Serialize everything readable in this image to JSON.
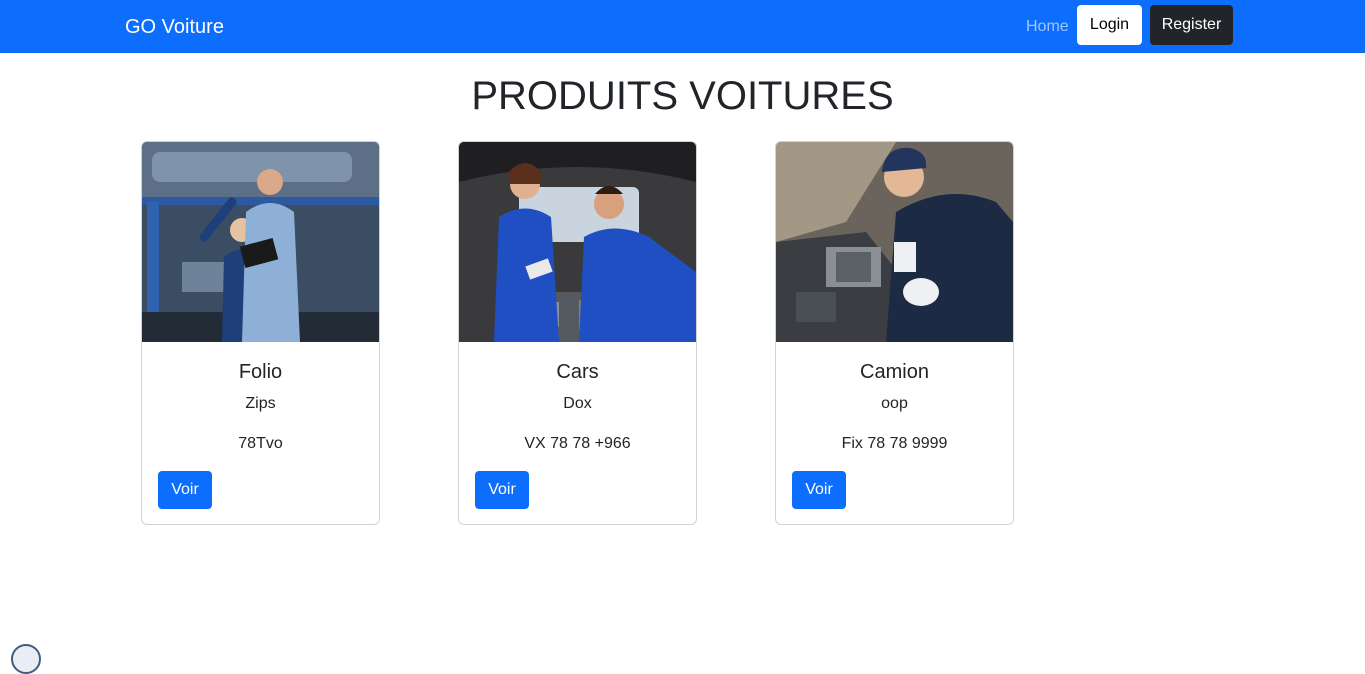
{
  "navbar": {
    "brand": "GO Voiture",
    "home_label": "Home",
    "login_label": "Login",
    "register_label": "Register",
    "background_color": "#0d6efd"
  },
  "page_title": "PRODUITS VOITURES",
  "products": [
    {
      "title": "Folio",
      "subtitle": "Zips",
      "reference": "78Tvo",
      "button_label": "Voir",
      "image": "mechanics-with-tablet-in-garage-photo"
    },
    {
      "title": "Cars",
      "subtitle": "Dox",
      "reference": "VX 78 78 +966",
      "button_label": "Voir",
      "image": "mechanics-under-car-hood-photo"
    },
    {
      "title": "Camion",
      "subtitle": "oop",
      "reference": "Fix 78 78 9999",
      "button_label": "Voir",
      "image": "smiling-mechanic-at-engine-photo"
    }
  ],
  "colors": {
    "primary": "#0d6efd",
    "dark": "#212529"
  }
}
